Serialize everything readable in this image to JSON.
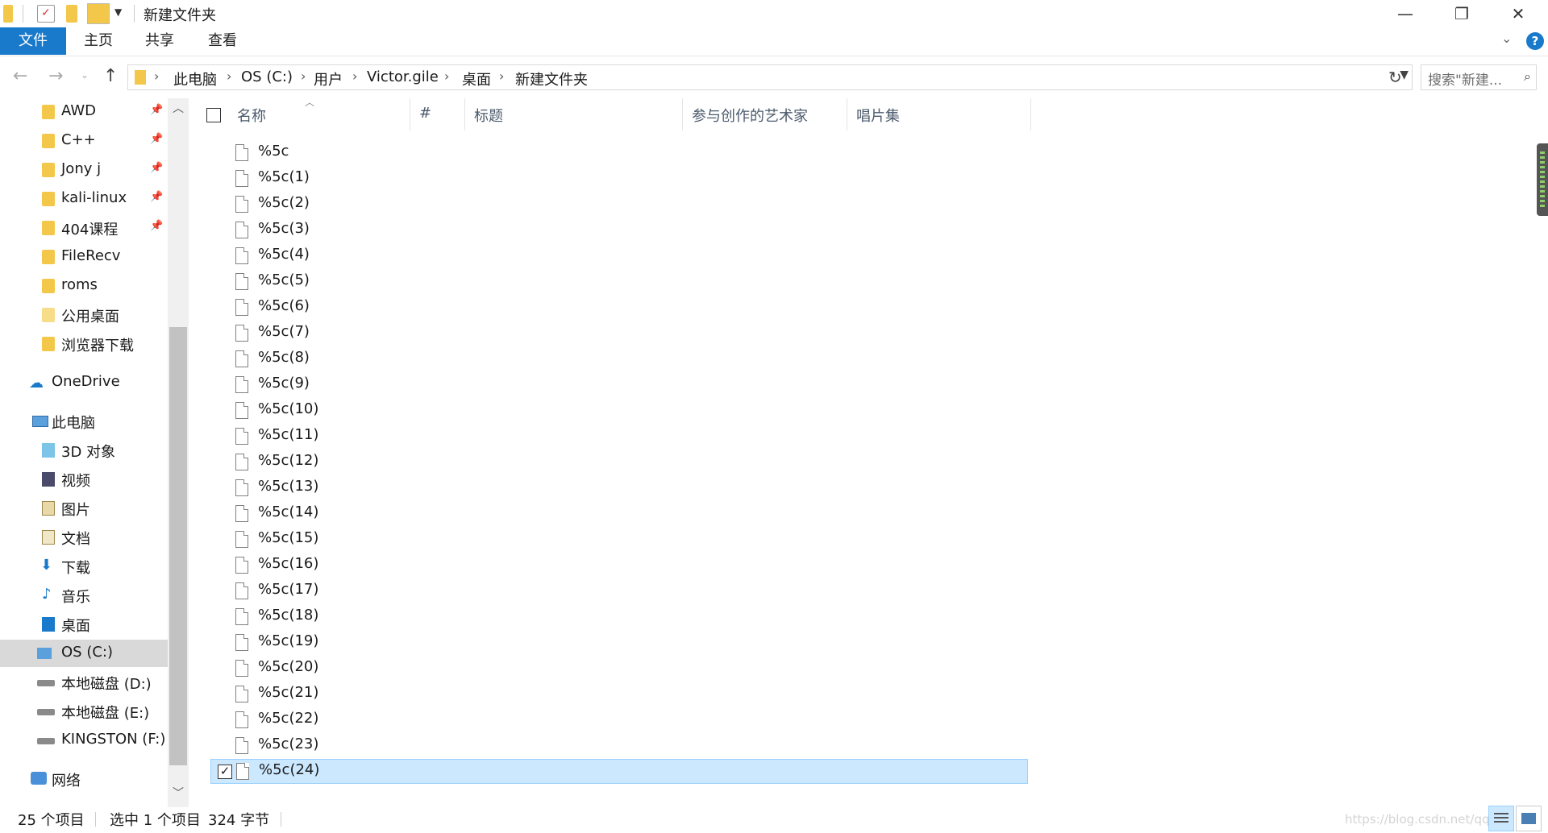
{
  "window": {
    "title": "新建文件夹"
  },
  "ribbon": {
    "tabs": [
      "文件",
      "主页",
      "共享",
      "查看"
    ]
  },
  "address": {
    "crumbs": [
      "此电脑",
      "OS (C:)",
      "用户",
      "Victor.gile",
      "桌面",
      "新建文件夹"
    ],
    "search_placeholder": "搜索\"新建..."
  },
  "sidebar": {
    "quick_access": [
      {
        "label": "AWD",
        "pinned": true
      },
      {
        "label": "C++",
        "pinned": true
      },
      {
        "label": "Jony j",
        "pinned": true
      },
      {
        "label": "kali-linux",
        "pinned": true
      },
      {
        "label": "404课程",
        "pinned": true
      },
      {
        "label": "FileRecv",
        "pinned": false
      },
      {
        "label": "roms",
        "pinned": false
      },
      {
        "label": "公用桌面",
        "pinned": false
      },
      {
        "label": "浏览器下载",
        "pinned": false
      }
    ],
    "onedrive": "OneDrive",
    "this_pc": "此电脑",
    "pc_items": [
      "3D 对象",
      "视频",
      "图片",
      "文档",
      "下载",
      "音乐",
      "桌面"
    ],
    "drives": [
      "OS (C:)",
      "本地磁盘 (D:)",
      "本地磁盘 (E:)",
      "KINGSTON (F:)"
    ],
    "selected": "OS (C:)",
    "network": "网络"
  },
  "columns": [
    "名称",
    "#",
    "标题",
    "参与创作的艺术家",
    "唱片集"
  ],
  "files": [
    "%5c",
    "%5c(1)",
    "%5c(2)",
    "%5c(3)",
    "%5c(4)",
    "%5c(5)",
    "%5c(6)",
    "%5c(7)",
    "%5c(8)",
    "%5c(9)",
    "%5c(10)",
    "%5c(11)",
    "%5c(12)",
    "%5c(13)",
    "%5c(14)",
    "%5c(15)",
    "%5c(16)",
    "%5c(17)",
    "%5c(18)",
    "%5c(19)",
    "%5c(20)",
    "%5c(21)",
    "%5c(22)",
    "%5c(23)",
    "%5c(24)"
  ],
  "selected_file": "%5c(24)",
  "status": {
    "item_count": "25 个项目",
    "selection": "选中 1 个项目",
    "size": "324 字节",
    "watermark": "https://blog.csdn.net/qq_"
  },
  "colors": {
    "accent": "#1979ca",
    "selection": "#cce8ff",
    "folder": "#f3c84a"
  }
}
